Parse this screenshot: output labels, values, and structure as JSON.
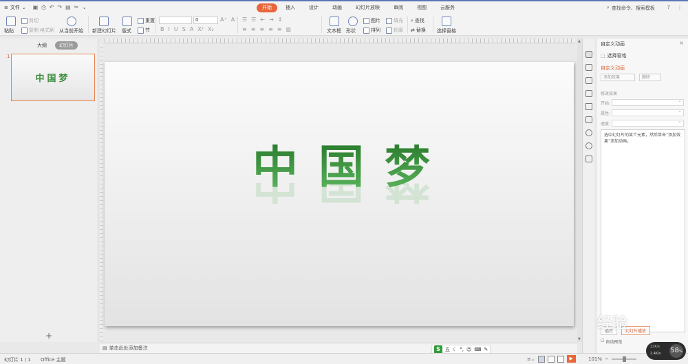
{
  "titlebar": {
    "file_menu": "文件",
    "tabs": [
      "开始",
      "插入",
      "设计",
      "动画",
      "幻灯片放映",
      "审阅",
      "视图",
      "云服务"
    ],
    "active_tab": "开始",
    "search_placeholder": "查找命令、搜索模板"
  },
  "ribbon": {
    "paste": "粘贴",
    "cut": "剪切",
    "copy": "复制",
    "format_painter": "格式刷",
    "from_current": "从当前开始",
    "new_slide": "新建幻灯片",
    "layout": "版式",
    "reset": "重置",
    "section": "节",
    "font_size": "0",
    "textbox": "文本框",
    "shape": "形状",
    "picture": "图片",
    "arrange": "排列",
    "fill": "填充",
    "outline": "轮廓",
    "find": "查找",
    "replace": "替换",
    "select_pane": "选择窗格"
  },
  "left_panel": {
    "tab_outline": "大纲",
    "tab_slides": "幻灯片",
    "slide_number": "1",
    "thumb_title": "中国梦",
    "add_icon": "+"
  },
  "slide": {
    "title": "中国梦",
    "title_color": "#2f8a33"
  },
  "notes": {
    "placeholder": "单击此处添加备注"
  },
  "task_pane": {
    "title": "自定义动画",
    "select_pane": "选择窗格",
    "section_title": "自定义动画",
    "add_effect": "添加效果",
    "delete": "删除",
    "modify_effect": "修改效果",
    "start_label": "开始:",
    "property_label": "属性:",
    "speed_label": "速度:",
    "hint": "选中幻灯片的某个元素，然后单击“添加效果”添加动画。",
    "play_button": "播放",
    "slideshow_button": "幻灯片播放",
    "auto_preview": "自动预览"
  },
  "ime_toolbar": {
    "logo": "S",
    "mode": "五"
  },
  "status_bar": {
    "slide_info": "幻灯片 1 / 1",
    "theme": "Office 主题",
    "zoom": "101%",
    "accent_color": "#e8663a"
  },
  "speed_widget": {
    "upload": "22K/s",
    "download": "2.4K/s",
    "value": "58",
    "unit": "%"
  },
  "watermark": {
    "text": "经验",
    "url": "jingyan"
  }
}
